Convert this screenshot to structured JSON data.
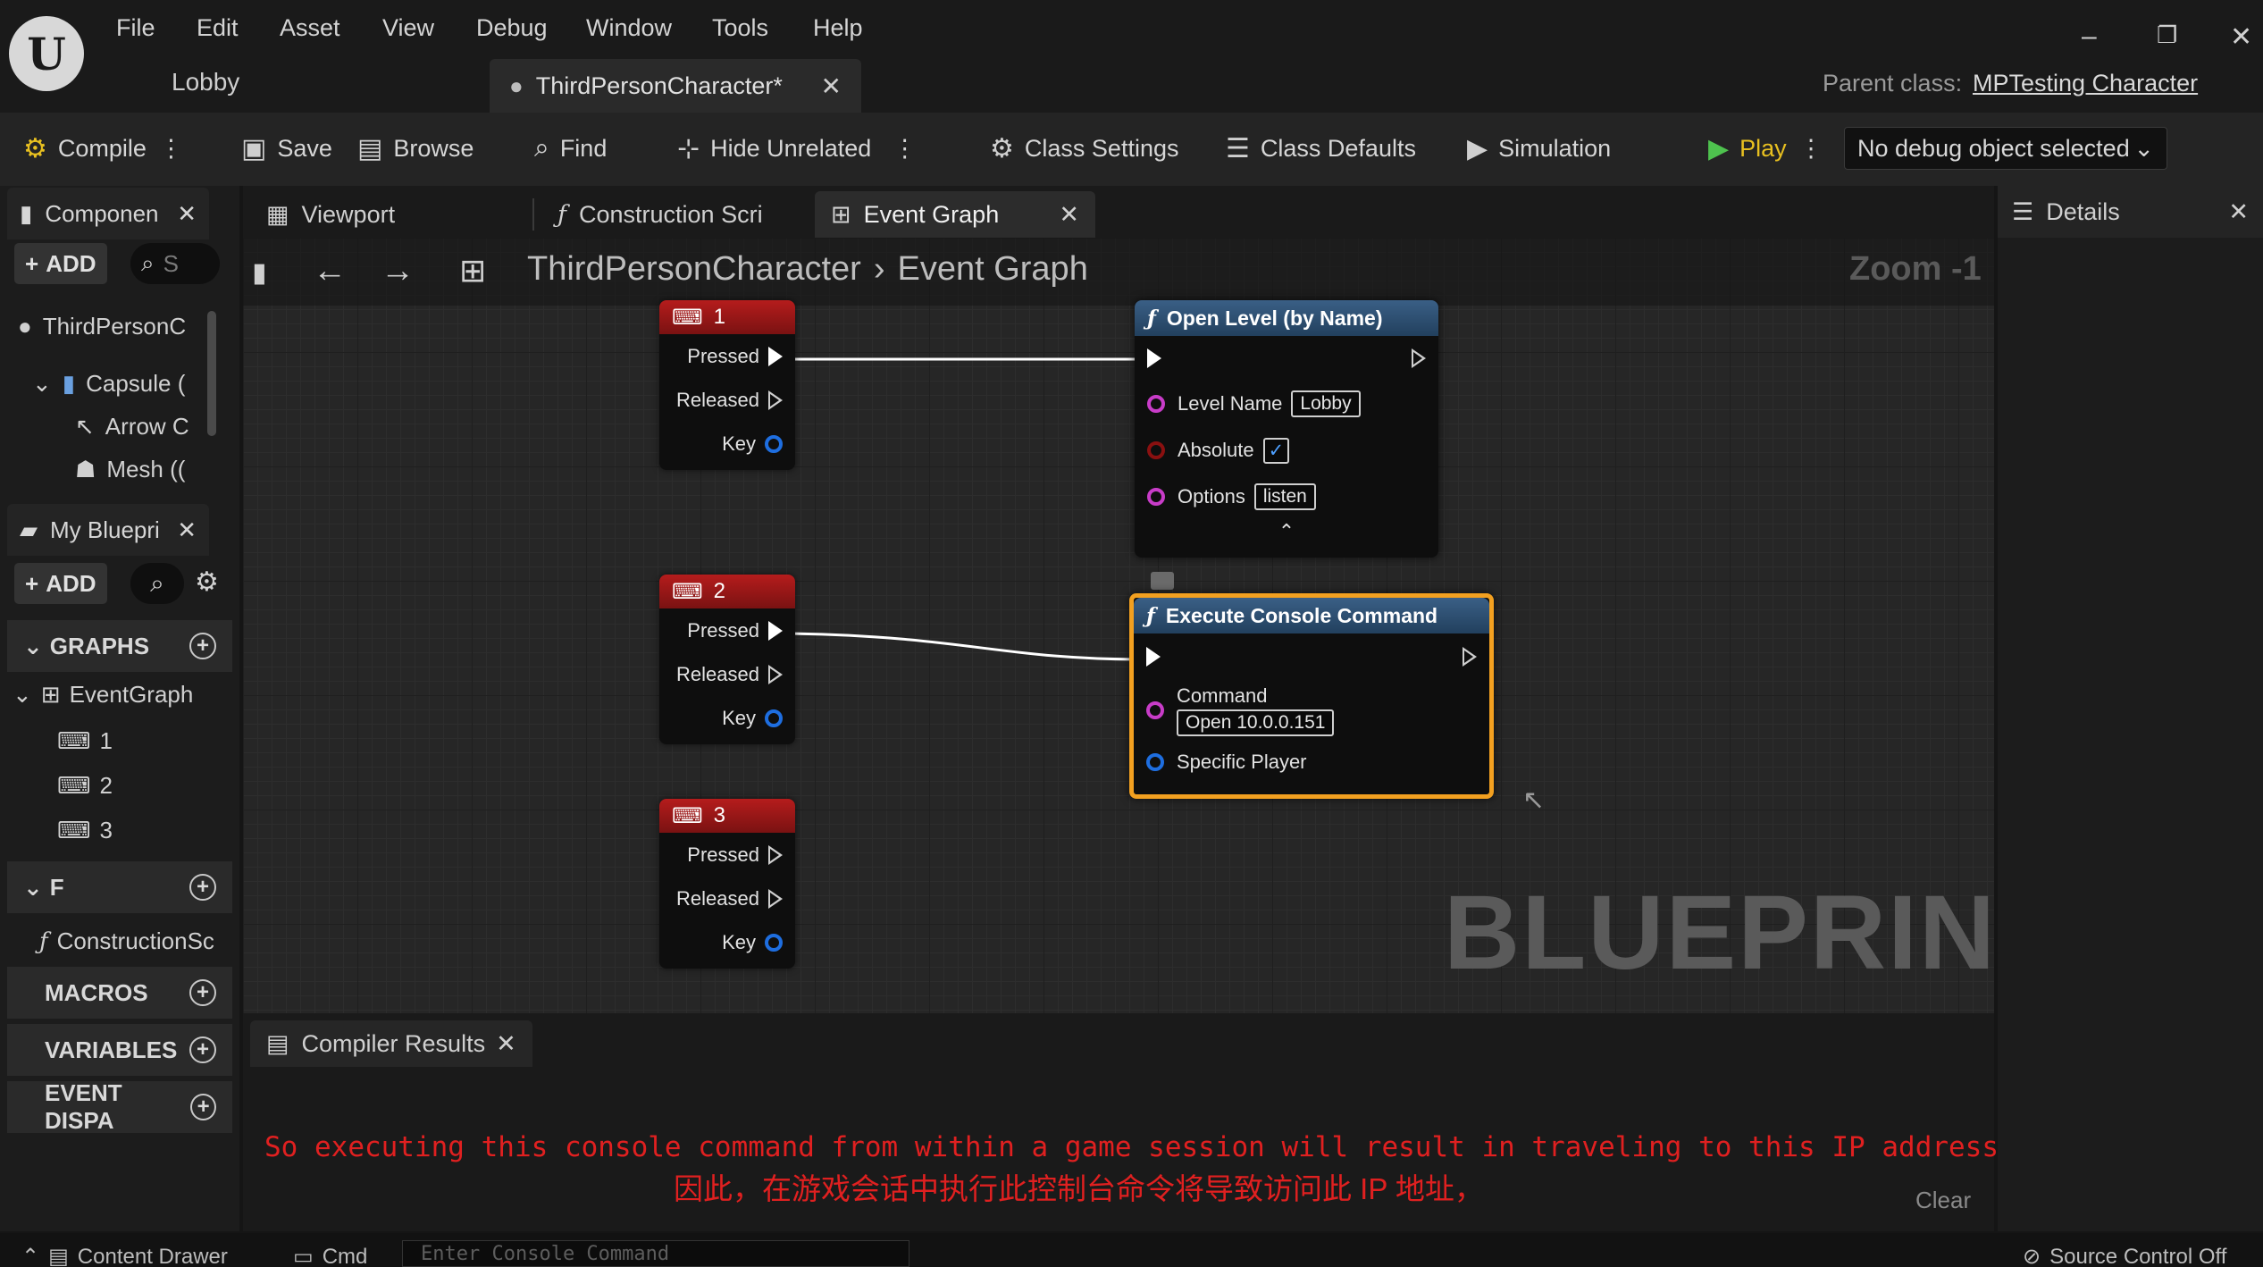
{
  "menu": [
    "File",
    "Edit",
    "Asset",
    "View",
    "Debug",
    "Window",
    "Tools",
    "Help"
  ],
  "project_name": "Lobby",
  "document_tab": "ThirdPersonCharacter*",
  "parent_class_label": "Parent class:",
  "parent_class_value": "MPTesting Character",
  "toolbar": {
    "compile": "Compile",
    "save": "Save",
    "browse": "Browse",
    "find": "Find",
    "hide_unrelated": "Hide Unrelated",
    "class_settings": "Class Settings",
    "class_defaults": "Class Defaults",
    "simulation": "Simulation",
    "play": "Play",
    "debug_object": "No debug object selected"
  },
  "components_panel": {
    "tab": "Componen",
    "add": "ADD",
    "search_placeholder": "S",
    "tree": [
      "ThirdPersonC",
      "Capsule (",
      "Arrow C",
      "Mesh (("
    ]
  },
  "my_blueprint_panel": {
    "tab": "My Bluepri",
    "add": "ADD",
    "graphs_label": "GRAPHS",
    "event_graph": "EventGraph",
    "graph_items": [
      "1",
      "2",
      "3"
    ],
    "functions_label": "F",
    "construction_script": "ConstructionSc",
    "macros_label": "MACROS",
    "variables_label": "VARIABLES",
    "event_dispatchers_label": "EVENT DISPA"
  },
  "graph_tabs": [
    "Viewport",
    "Construction Scri",
    "Event Graph"
  ],
  "breadcrumb": {
    "root": "ThirdPersonCharacter",
    "current": "Event Graph"
  },
  "zoom": "Zoom -1",
  "watermark": "BLUEPRINT",
  "key_nodes": [
    {
      "title": "1",
      "pins": [
        "Pressed",
        "Released",
        "Key"
      ]
    },
    {
      "title": "2",
      "pins": [
        "Pressed",
        "Released",
        "Key"
      ]
    },
    {
      "title": "3",
      "pins": [
        "Pressed",
        "Released",
        "Key"
      ]
    }
  ],
  "open_level_node": {
    "title": "Open Level (by Name)",
    "level_name_label": "Level Name",
    "level_name_value": "Lobby",
    "absolute_label": "Absolute",
    "absolute_checked": true,
    "options_label": "Options",
    "options_value": "listen"
  },
  "console_node": {
    "title": "Execute Console Command",
    "command_label": "Command",
    "command_value": "Open 10.0.0.151",
    "player_label": "Specific Player"
  },
  "compiler": {
    "tab": "Compiler Results",
    "clear": "Clear"
  },
  "subtitles": {
    "en": "So executing this console command from within a game session will result in traveling to this IP address,",
    "zh": "因此，在游戏会话中执行此控制台命令将导致访问此 IP 地址，"
  },
  "details_panel": {
    "title": "Details"
  },
  "statusbar": {
    "content_drawer": "Content Drawer",
    "cmd": "Cmd",
    "cmd_placeholder": "Enter Console Command",
    "source_control": "Source Control Off"
  },
  "colors": {
    "exec_wire": "#ffffff",
    "key_node_header": "#b51c1c",
    "function_node_header": "#3a5f86",
    "selection_outline": "#f2a020",
    "subtitle": "#e02020",
    "play_icon": "#4ec24e"
  }
}
